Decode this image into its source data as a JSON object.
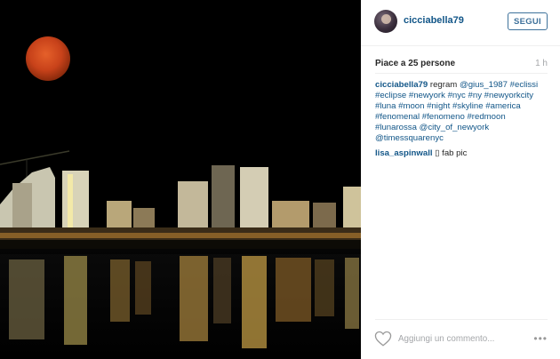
{
  "post": {
    "username": "cicciabella79",
    "follow_label": "SEGUI",
    "likes_text": "Piace a 25 persone",
    "time_ago": "1 h",
    "caption_user": "cicciabella79",
    "caption_text": "regram",
    "caption_mention": "@gius_1987",
    "caption_tags": "#eclissi #eclipse #newyork #nyc #ny #newyorkcity #luna #moon #night #skyline #america #fenomenal #fenomeno #redmoon #lunarossa @city_of_newyork @timessquarenyc",
    "comment_user": "lisa_aspinwall",
    "comment_text": "▯ fab pic",
    "add_comment_placeholder": "Aggiungi un commento...",
    "more_label": "•••"
  },
  "icons": {
    "heart": "heart-icon",
    "more": "more-options-icon"
  },
  "colors": {
    "link": "#125688",
    "follow": "#3f729b",
    "moon": "#c8421a"
  }
}
